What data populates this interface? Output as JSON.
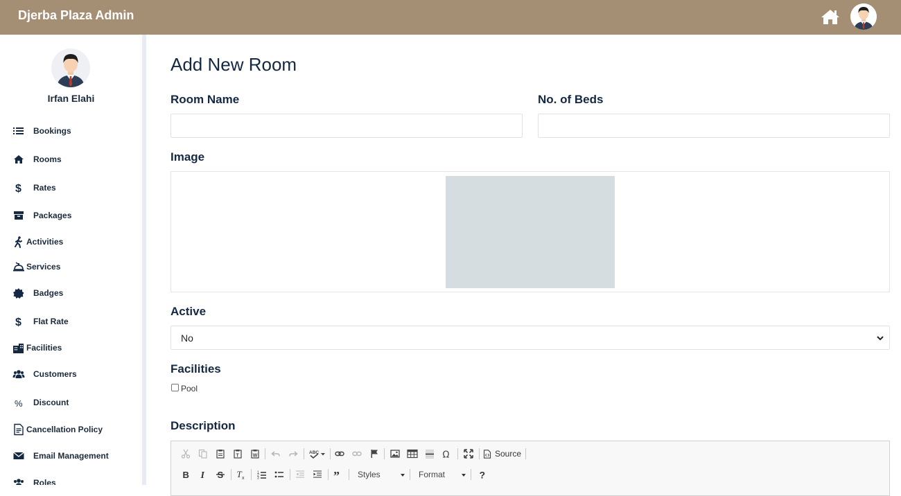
{
  "app": {
    "title": "Djerba Plaza Admin"
  },
  "header": {
    "home_icon": "home-icon",
    "avatar": "user-avatar"
  },
  "profile": {
    "name": "Irfan Elahi"
  },
  "sidebar": {
    "items": [
      {
        "label": "Bookings",
        "icon": "list-icon"
      },
      {
        "label": "Rooms",
        "icon": "home-icon"
      },
      {
        "label": "Rates",
        "icon": "dollar-icon"
      },
      {
        "label": "Packages",
        "icon": "archive-icon"
      },
      {
        "label": "Activities",
        "icon": "running-icon"
      },
      {
        "label": "Services",
        "icon": "concierge-bell-icon"
      },
      {
        "label": "Badges",
        "icon": "badge-icon"
      },
      {
        "label": "Flat Rate",
        "icon": "dollar-icon"
      },
      {
        "label": "Facilities",
        "icon": "building-icon"
      },
      {
        "label": "Customers",
        "icon": "users-icon"
      },
      {
        "label": "Discount",
        "icon": "percent-icon"
      },
      {
        "label": "Cancellation Policy",
        "icon": "document-icon"
      },
      {
        "label": "Email Management",
        "icon": "envelope-icon"
      },
      {
        "label": "Roles",
        "icon": "users-icon"
      }
    ]
  },
  "form": {
    "title": "Add New Room",
    "room_name_label": "Room Name",
    "room_name_value": "",
    "beds_label": "No. of Beds",
    "beds_value": "",
    "image_label": "Image",
    "active_label": "Active",
    "active_value": "No",
    "facilities_label": "Facilities",
    "facilities": [
      {
        "label": "Pool",
        "checked": false
      }
    ],
    "description_label": "Description"
  },
  "editor": {
    "source_label": "Source",
    "styles_label": "Styles",
    "format_label": "Format",
    "row1_icons": [
      "cut-icon",
      "copy-icon",
      "paste-icon",
      "paste-text-icon",
      "paste-word-icon",
      "undo-icon",
      "redo-icon",
      "spellcheck-icon",
      "link-icon",
      "unlink-icon",
      "anchor-icon",
      "image-icon",
      "table-icon",
      "horizontal-line-icon",
      "special-char-icon",
      "maximize-icon",
      "source-icon"
    ],
    "row2_icons": [
      "bold-icon",
      "italic-icon",
      "strikethrough-icon",
      "remove-format-icon",
      "numbered-list-icon",
      "bulleted-list-icon",
      "outdent-icon",
      "indent-icon",
      "blockquote-icon",
      "help-icon"
    ]
  }
}
